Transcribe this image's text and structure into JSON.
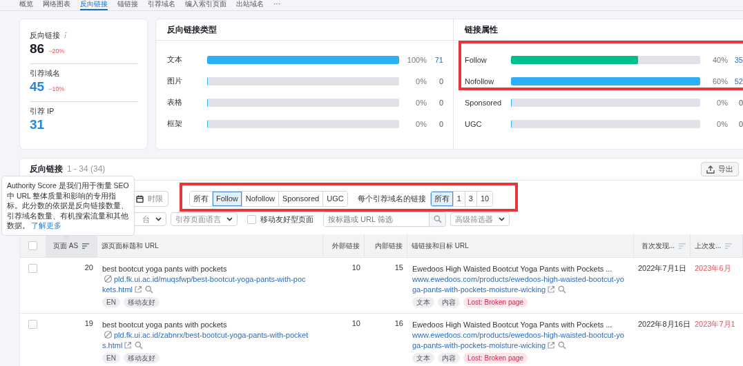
{
  "tabs": [
    {
      "label": "概览",
      "selected": false
    },
    {
      "label": "网络图表",
      "selected": false
    },
    {
      "label": "反向链接",
      "selected": true
    },
    {
      "label": "锚链接",
      "selected": false
    },
    {
      "label": "引荐域名",
      "selected": false
    },
    {
      "label": "编入索引页面",
      "selected": false
    },
    {
      "label": "出站域名",
      "selected": false
    },
    {
      "label": "···",
      "selected": false
    }
  ],
  "summary": [
    {
      "label": "反向链接",
      "info": true,
      "value": "86",
      "link": false,
      "change": "−20%"
    },
    {
      "label": "引荐域名",
      "value": "45",
      "link": true,
      "change": "−10%"
    },
    {
      "label": "引荐 IP",
      "value": "31",
      "link": true
    }
  ],
  "backlink_types": {
    "title": "反向链接类型",
    "rows": [
      {
        "label": "文本",
        "level": 1,
        "color": "#2bb0f7",
        "percent": "100%",
        "count": "71"
      },
      {
        "label": "图片",
        "level": 0,
        "percent": "0%",
        "count": "0"
      },
      {
        "label": "表格",
        "level": 0,
        "percent": "0%",
        "count": "0"
      },
      {
        "label": "框架",
        "level": 0,
        "percent": "0%",
        "count": "0"
      }
    ]
  },
  "link_attributes": {
    "title": "链接属性",
    "rows": [
      {
        "label": "Follow",
        "level": 0.67,
        "color": "#00c08b",
        "percent": "40%",
        "count": "35"
      },
      {
        "label": "Nofollow",
        "level": 1,
        "color": "#2bb0f7",
        "percent": "60%",
        "count": "52"
      },
      {
        "label": "Sponsored",
        "level": 0,
        "percent": "0%",
        "count": "0"
      },
      {
        "label": "UGC",
        "level": 0,
        "percent": "0%",
        "count": "0"
      }
    ]
  },
  "backlinks": {
    "title": "反向链接",
    "range": "1 - 34 (34)",
    "export": "导出",
    "tooltip": {
      "text": "Authority Score 是我们用于衡量 SEO 中 URL 整体质量和影响的专用指标。此分数的依据是反向链接数量、引荐域名数量、有机搜索流量和其他数据。",
      "link": "了解更多"
    },
    "period_button": "时限",
    "type_filter": [
      {
        "label": "所有",
        "selected": false
      },
      {
        "label": "Follow",
        "selected": true
      },
      {
        "label": "Nofollow",
        "selected": false
      },
      {
        "label": "Sponsored",
        "selected": false
      },
      {
        "label": "UGC",
        "selected": false
      }
    ],
    "per_domain_label": "每个引荐域名的链接",
    "per_domain": [
      {
        "label": "所有",
        "selected": true
      },
      {
        "label": "1",
        "selected": false
      },
      {
        "label": "3",
        "selected": false
      },
      {
        "label": "10",
        "selected": false
      }
    ],
    "dropdowns": [
      "台",
      "引荐页面语言"
    ],
    "mobile_filter": {
      "label": "移动友好型页面",
      "checked": false
    },
    "search": {
      "placeholder": "按标题或 URL 筛选"
    },
    "advanced_filter": "高级筛选器",
    "select_all": {
      "checked": false
    },
    "columns": [
      {
        "label": "页面 AS",
        "sorted": true
      },
      {
        "label": "源页面标题和 URL"
      },
      {
        "label": "外部链接"
      },
      {
        "label": "内部链接"
      },
      {
        "label": "锚链接和目标 URL"
      },
      {
        "label": "首次发现...",
        "sorted": false
      },
      {
        "label": "上次发...",
        "sorted": false
      }
    ],
    "rows": [
      {
        "checked": false,
        "page_as": "20",
        "title": "best bootcut yoga pants with pockets",
        "url": "pld.fk.ui.ac.id/muqsfwp/best-bootcut-yoga-pants-with-pockets.html",
        "tags": [
          "EN",
          "移动友好"
        ],
        "external": "10",
        "internal": "15",
        "anchor": "Ewedoos High Waisted Bootcut Yoga Pants with Pockets ...",
        "target": "www.ewedoos.com/products/ewedoos-high-waisted-bootcut-yoga-pants-with-pockets-moisture-wicking",
        "target_tags": [
          {
            "label": "文本",
            "kind": "plain"
          },
          {
            "label": "内容",
            "kind": "plain"
          },
          {
            "label": "Lost: Broken page",
            "kind": "lost"
          }
        ],
        "first_seen": "2022年7月1日",
        "last_seen": "2023年6月"
      },
      {
        "checked": false,
        "page_as": "19",
        "title": "best bootcut yoga pants with pockets",
        "url": "pld.fk.ui.ac.id/zabnrx/best-bootcut-yoga-pants-with-pockets.html",
        "tags": [
          "EN",
          "移动友好"
        ],
        "external": "10",
        "internal": "16",
        "anchor": "Ewedoos High Waisted Bootcut Yoga Pants with Pockets ...",
        "target": "www.ewedoos.com/products/ewedoos-high-waisted-bootcut-yoga-pants-with-pockets-moisture-wicking",
        "target_tags": [
          {
            "label": "文本",
            "kind": "plain"
          },
          {
            "label": "内容",
            "kind": "plain"
          },
          {
            "label": "Lost: Broken page",
            "kind": "lost"
          }
        ],
        "first_seen": "2022年8月16日",
        "last_seen": "2023年7月1"
      }
    ]
  }
}
